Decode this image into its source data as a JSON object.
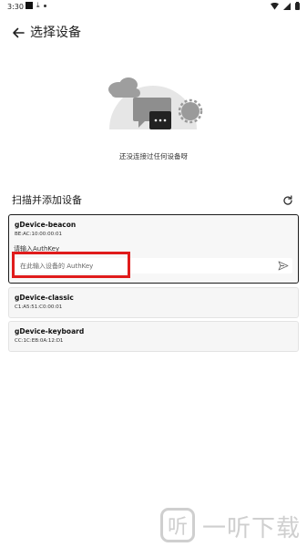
{
  "status_bar": {
    "time": "3:30"
  },
  "header": {
    "title": "选择设备"
  },
  "empty_state": {
    "text": "还没连接过任何设备呀"
  },
  "scan_section": {
    "title": "扫描并添加设备"
  },
  "devices": [
    {
      "name": "gDevice-beacon",
      "mac": "BE:AC:10:00:00:01",
      "auth_label": "请输入AuthKey",
      "auth_placeholder": "在此输入设备的 AuthKey"
    },
    {
      "name": "gDevice-classic",
      "mac": "C1:A5:51:C0:00:01"
    },
    {
      "name": "gDevice-keyboard",
      "mac": "CC:1C:EB:0A:12:D1"
    }
  ],
  "watermark": {
    "icon_text": "听",
    "text": "一听下载"
  },
  "colors": {
    "highlight": "#e01c1c",
    "selected_border": "#1b1b1b",
    "card_bg": "#f6f6f6"
  }
}
